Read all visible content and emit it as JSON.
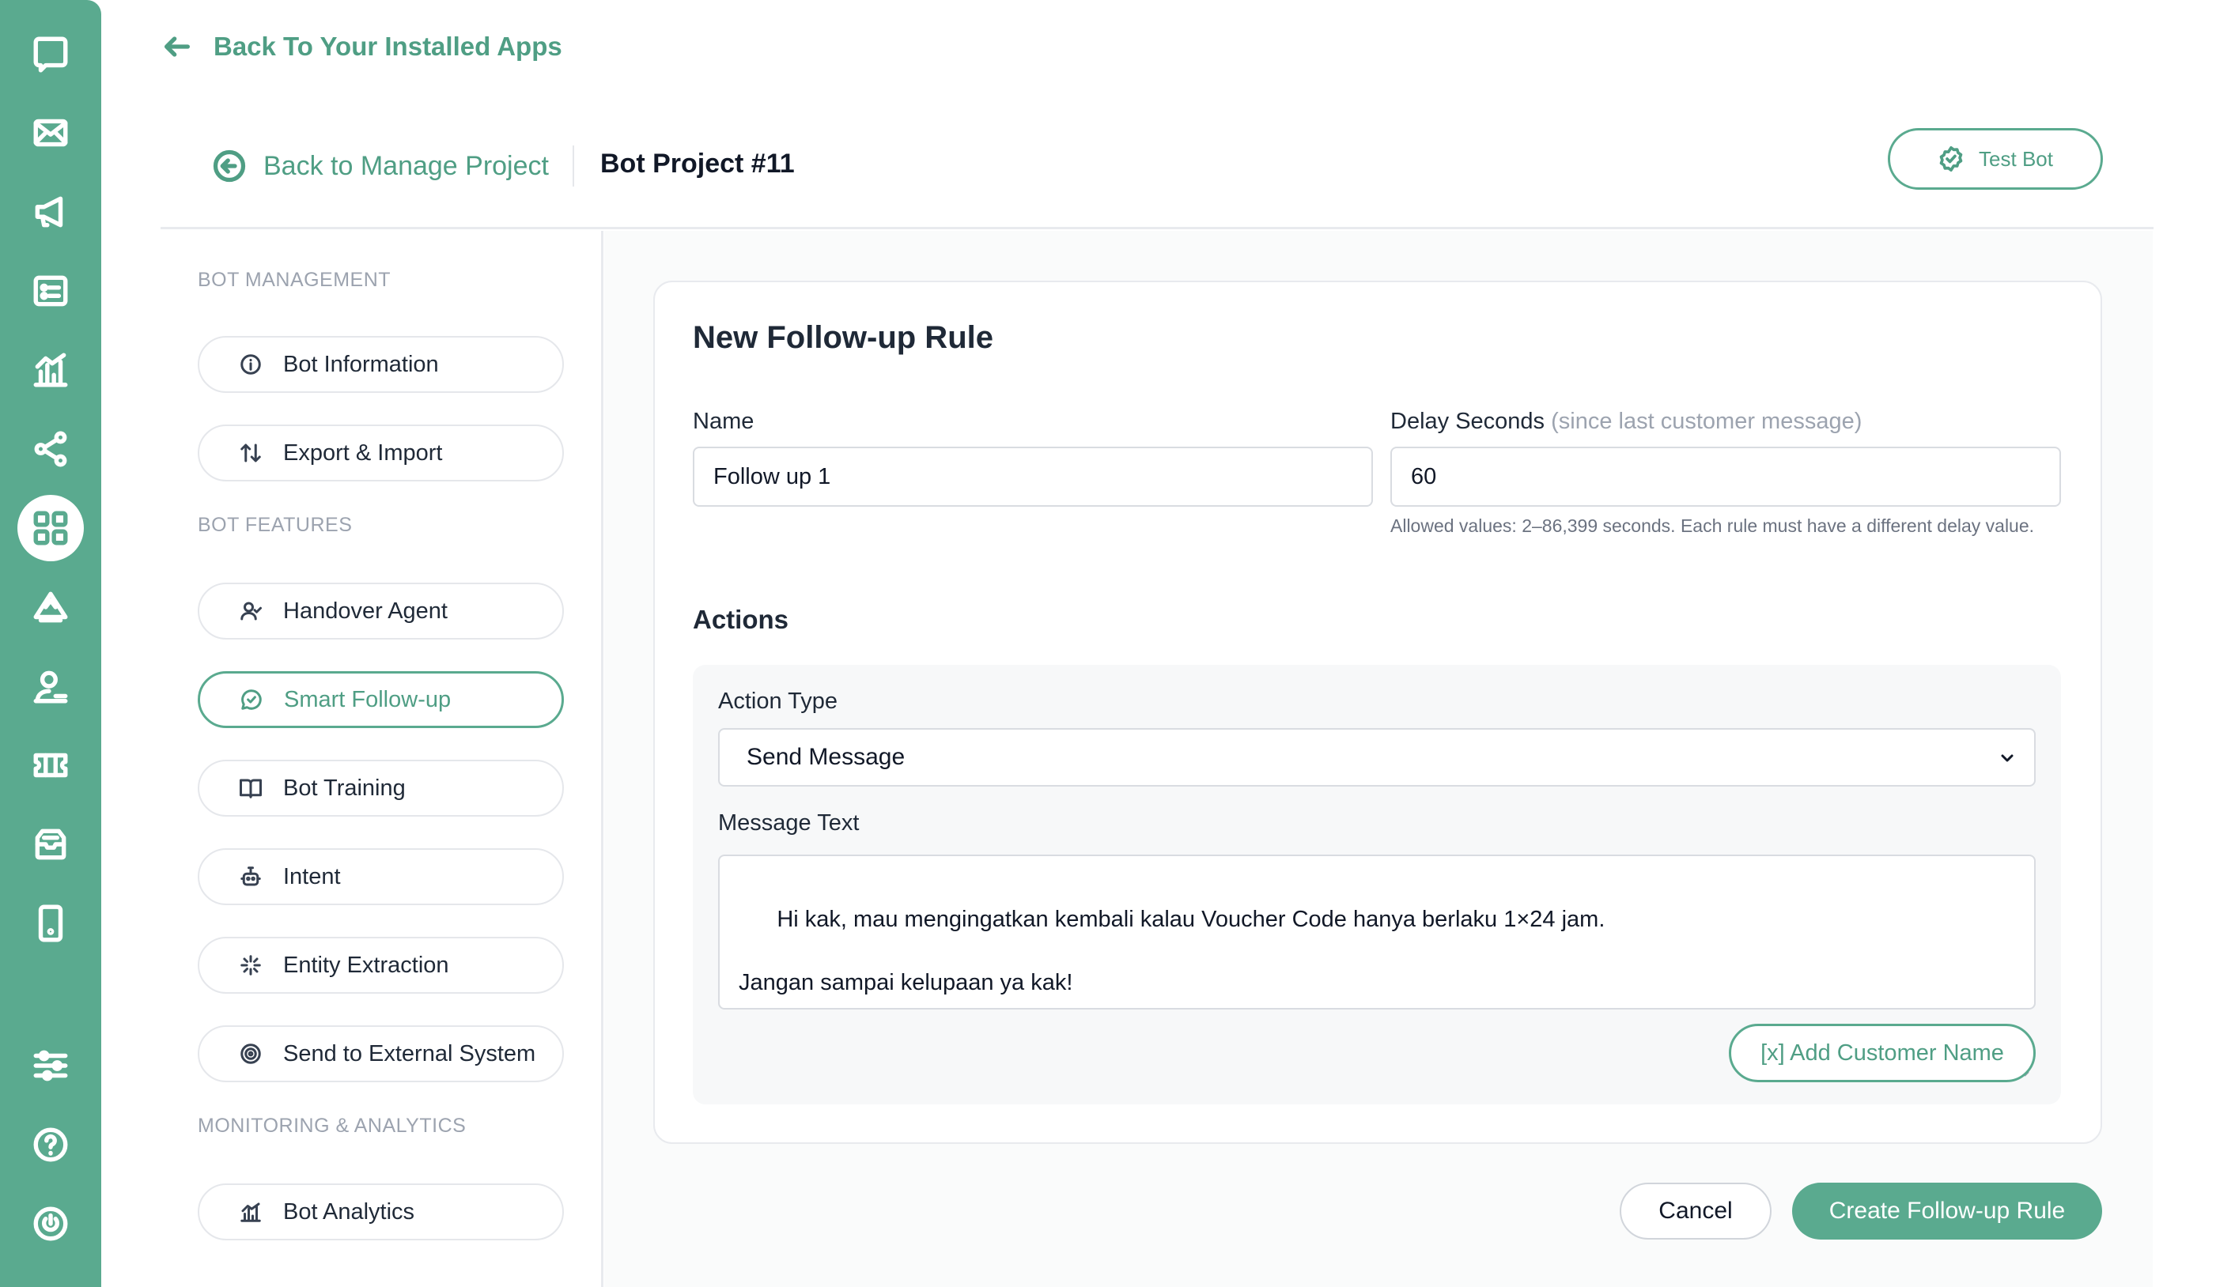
{
  "rail": {
    "icons": [
      "chat-icon",
      "mail-icon",
      "megaphone-icon",
      "contact-card-icon",
      "analytics-icon",
      "share-nodes-icon",
      "apps-grid-icon",
      "broadcast-icon",
      "agent-icon",
      "ticket-icon",
      "inbox-stack-icon",
      "mobile-icon",
      "sliders-icon",
      "help-icon",
      "power-icon"
    ],
    "active": "apps-grid-icon",
    "color": "#5aaa8f"
  },
  "top": {
    "back_label": "Back To Your Installed Apps"
  },
  "header": {
    "back_manage_label": "Back to Manage Project",
    "project_title": "Bot Project #11",
    "test_bot_label": "Test Bot"
  },
  "sidenav": {
    "sections": [
      {
        "label": "BOT MANAGEMENT",
        "items": [
          {
            "label": "Bot Information",
            "icon": "info-icon"
          },
          {
            "label": "Export & Import",
            "icon": "swap-vertical-icon"
          }
        ]
      },
      {
        "label": "BOT FEATURES",
        "items": [
          {
            "label": "Handover Agent",
            "icon": "user-check-icon"
          },
          {
            "label": "Smart Follow-up",
            "icon": "chat-check-icon",
            "active": true
          },
          {
            "label": "Bot Training",
            "icon": "book-open-icon"
          },
          {
            "label": "Intent",
            "icon": "robot-icon"
          },
          {
            "label": "Entity Extraction",
            "icon": "sparkle-icon"
          },
          {
            "label": "Send to External System",
            "icon": "target-icon"
          }
        ]
      },
      {
        "label": "MONITORING & ANALYTICS",
        "items": [
          {
            "label": "Bot Analytics",
            "icon": "bar-chart-icon"
          }
        ]
      }
    ]
  },
  "form": {
    "title": "New Follow-up Rule",
    "name_label": "Name",
    "name_value": "Follow up 1",
    "delay_label": "Delay Seconds",
    "delay_sublabel": "(since last customer message)",
    "delay_value": "60",
    "delay_hint": "Allowed values: 2–86,399 seconds. Each rule must have a different delay value.",
    "actions_title": "Actions",
    "action_type_label": "Action Type",
    "action_type_value": "Send Message",
    "message_label": "Message Text",
    "message_value": "Hi kak, mau mengingatkan kembali kalau Voucher Code hanya berlaku 1×24 jam.\n\nJangan sampai kelupaan ya kak!",
    "add_name_label": "[x] Add Customer Name"
  },
  "footer": {
    "cancel_label": "Cancel",
    "create_label": "Create Follow-up Rule"
  },
  "colors": {
    "accent": "#5aaa8f",
    "accent_text": "#4f9e84"
  }
}
